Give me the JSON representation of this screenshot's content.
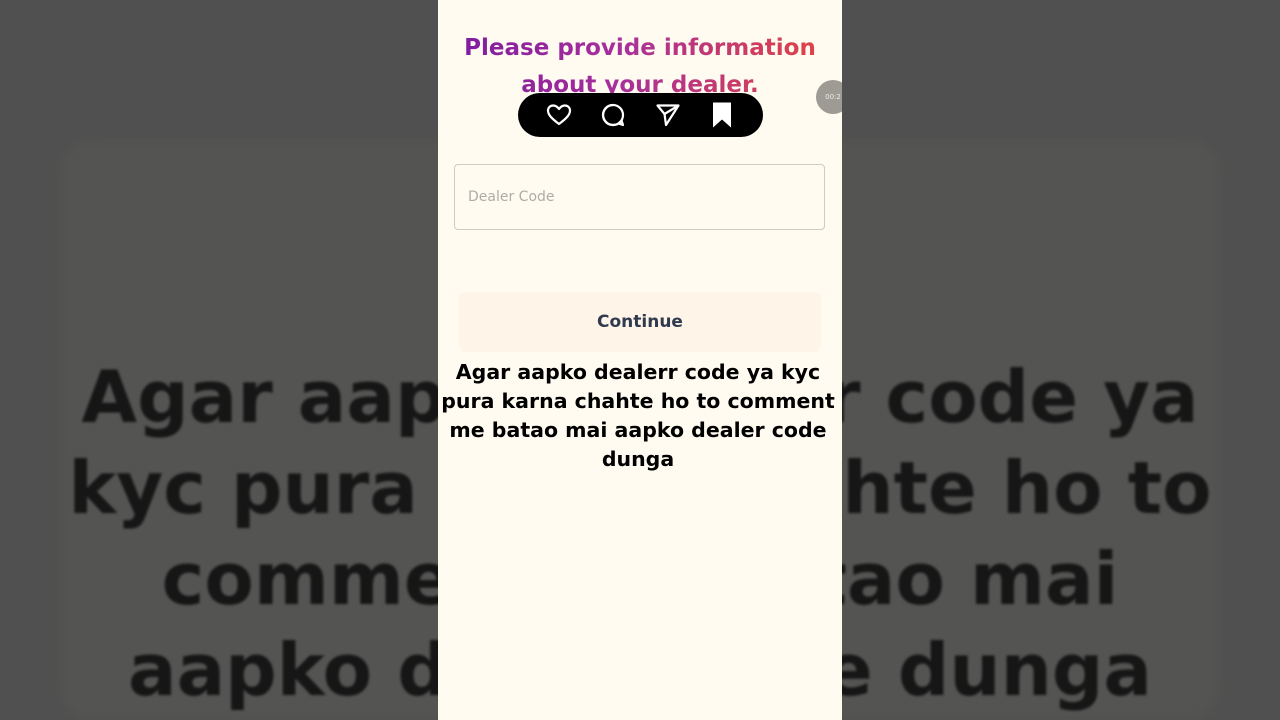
{
  "screen": {
    "heading": "Please provide information about your dealer.",
    "dealer_input": {
      "placeholder": "Dealer Code",
      "value": ""
    },
    "continue_label": "Continue",
    "recording_timer": "00:2"
  },
  "action_bar": {
    "icons": [
      "heart-icon",
      "comment-icon",
      "send-icon",
      "bookmark-icon"
    ]
  },
  "caption": {
    "text": "Agar aapko dealerr code ya kyc pura karna chahte ho to comment me batao mai aapko dealer code dunga"
  },
  "colors": {
    "page_bg": "#fffbf1",
    "heading_gradient_start": "#7a1aa0",
    "heading_gradient_end": "#e6453c",
    "button_bg": "#fff4e8",
    "button_text": "#2f3a4e",
    "action_bar_bg": "#000000"
  }
}
